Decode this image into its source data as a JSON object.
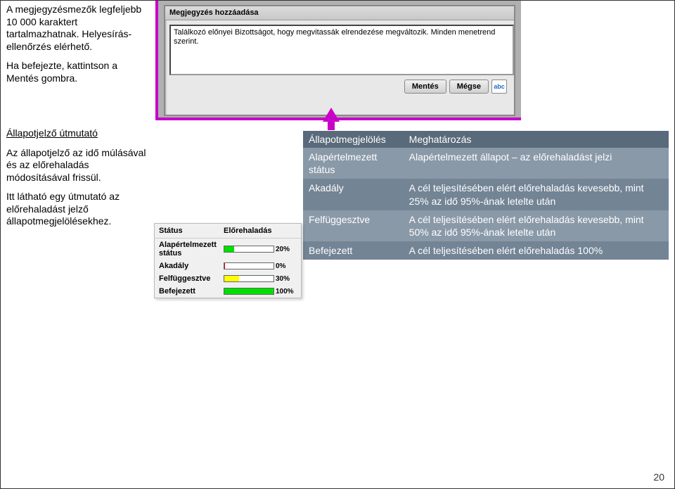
{
  "leftTop": {
    "p1": "A megjegyzésmezők legfeljebb 10 000 karaktert tartalmazhatnak. Helyesírás-ellenőrzés elérhető.",
    "p2": "Ha befejezte, kattintson a Mentés gombra."
  },
  "leftBottom": {
    "heading": "Állapotjelző útmutató",
    "p1": "Az állapotjelző az idő múlásával és az előrehaladás módosításával frissül.",
    "p2": "Itt látható egy útmutató az előrehaladást jelző állapotmegjelölésekhez."
  },
  "shot": {
    "titlebar": "Megjegyzés hozzáadása",
    "textarea": "Találkozó előnyei Bizottságot, hogy megvitassák elrendezése megváltozik. Minden menetrend szerint.",
    "saveBtn": "Mentés",
    "cancelBtn": "Mégse",
    "spellIcon": "spellcheck-icon",
    "spellGlyph": "abc"
  },
  "statusTable": {
    "headers": [
      "Állapotmegjelölés",
      "Meghatározás"
    ],
    "rows": [
      {
        "label": "Alapértelmezett státus",
        "def": "Alapértelmezett állapot – az előrehaladást jelzi"
      },
      {
        "label": "Akadály",
        "def": "A cél teljesítésében elért előrehaladás kevesebb, mint 25% az idő 95%-ának letelte után"
      },
      {
        "label": "Felfüggesztve",
        "def": "A cél teljesítésében elért előrehaladás kevesebb, mint 50% az idő 95%-ának letelte után"
      },
      {
        "label": "Befejezett",
        "def": "A cél teljesítésében elért előrehaladás 100%"
      }
    ]
  },
  "mini": {
    "col1": "Státus",
    "col2": "Előrehaladás",
    "rows": [
      {
        "label": "Alapértelmezett státus",
        "bar": "bar-green",
        "width": "20%",
        "pct": "20%"
      },
      {
        "label": "Akadály",
        "bar": "bar-red",
        "width": "2%",
        "pct": "0%"
      },
      {
        "label": "Felfüggesztve",
        "bar": "bar-yellow",
        "width": "30%",
        "pct": "30%"
      },
      {
        "label": "Befejezett",
        "bar": "bar-green",
        "width": "100%",
        "pct": "100%"
      }
    ]
  },
  "pageNumber": "20"
}
